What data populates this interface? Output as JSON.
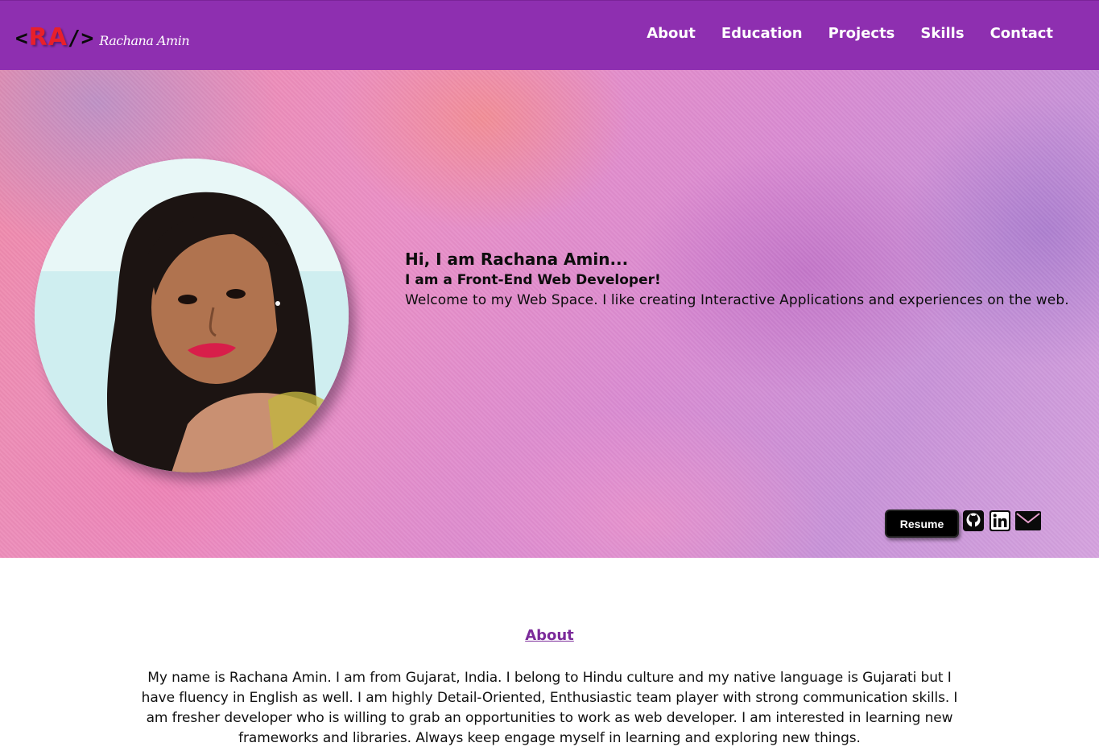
{
  "navbar": {
    "logo": {
      "open_bracket": "<",
      "initials": "RA",
      "close_bracket": "/>",
      "name": "Rachana Amin"
    },
    "links": [
      "About",
      "Education",
      "Projects",
      "Skills",
      "Contact"
    ]
  },
  "hero": {
    "greeting": "Hi, I am Rachana Amin...",
    "role": "I am a Front-End Web Developer!",
    "welcome": "Welcome to my Web Space. I like creating Interactive Applications and experiences on the web.",
    "resume_label": "Resume",
    "social_icons": [
      "github-icon",
      "linkedin-icon",
      "mail-icon"
    ]
  },
  "about": {
    "heading": "About",
    "text": "My name is Rachana Amin. I am from Gujarat, India. I belong to Hindu culture and my native language is Gujarati but I have fluency in English as well. I am highly Detail-Oriented, Enthusiastic team player with strong communication skills. I am fresher developer who is willing to grab an opportunities to work as web developer. I am interested in learning new frameworks and libraries. Always keep engage myself in learning and exploring new things."
  },
  "colors": {
    "navbar": "#8e2fb0",
    "logo_initials": "#e8202a",
    "about_heading": "#7b2a9a",
    "resume_button": "#000000"
  }
}
